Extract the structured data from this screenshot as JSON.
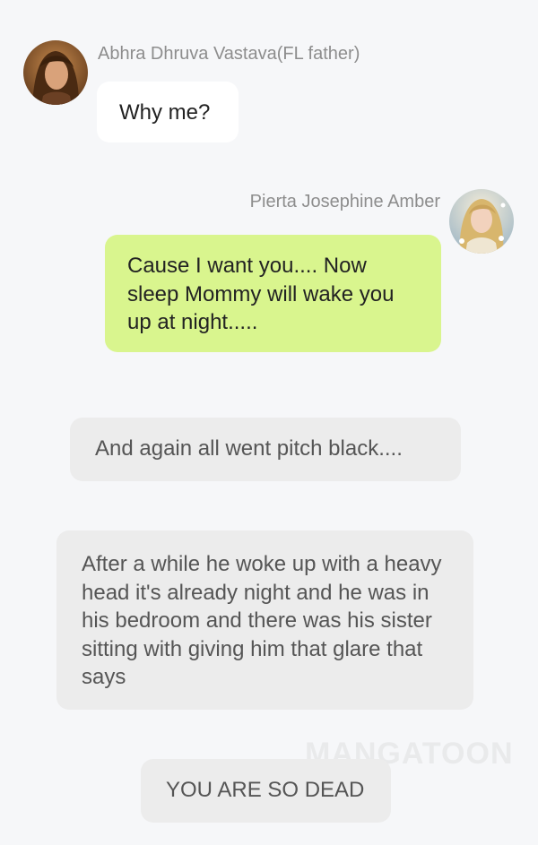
{
  "messages": [
    {
      "sender": "Abhra Dhruva Vastava(FL father)",
      "text": "Why me?",
      "side": "left"
    },
    {
      "sender": "Pierta Josephine Amber",
      "text": "Cause I want you.... Now sleep Mommy will wake you up at night.....",
      "side": "right",
      "bubble_color": "#d9f58e"
    }
  ],
  "narrations": [
    "And again all went pitch black....",
    "After a while he woke up with a heavy head it's already night and he was in his bedroom and there was his sister sitting with giving him that glare that says",
    "YOU ARE SO DEAD"
  ],
  "watermark": "MANGATOON",
  "colors": {
    "background": "#f6f7f9",
    "narration_bg": "#ececec",
    "left_bubble_bg": "#ffffff"
  }
}
